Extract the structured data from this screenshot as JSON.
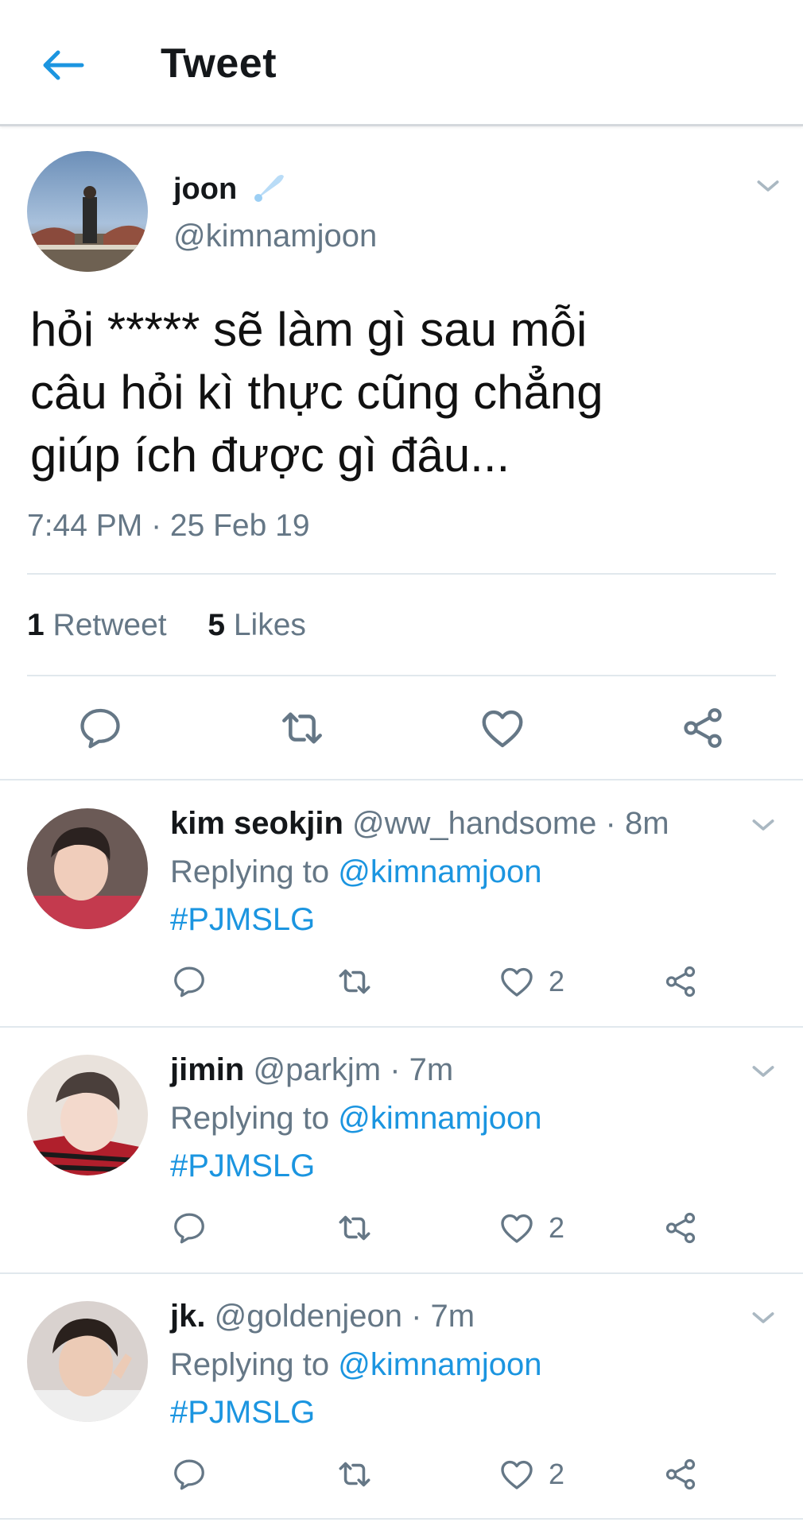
{
  "header": {
    "title": "Tweet"
  },
  "tweet": {
    "name": "joon",
    "handle": "@kimnamjoon",
    "text_lines": [
      "hỏi ***** sẽ làm gì sau mỗi",
      "câu hỏi kì thực cũng chẳng",
      "giúp ích được gì đâu..."
    ],
    "timestamp": "7:44 PM · 25 Feb 19",
    "retweets_count": "1",
    "retweets_label": "Retweet",
    "likes_count": "5",
    "likes_label": "Likes"
  },
  "replies": [
    {
      "name": "kim seokjin",
      "handle": "@ww_handsome",
      "time": "· 8m",
      "replying_label": "Replying to",
      "replying_to": "@kimnamjoon",
      "text": "#PJMSLG",
      "likes": "2"
    },
    {
      "name": "jimin",
      "handle": "@parkjm",
      "time": "· 7m",
      "replying_label": "Replying to",
      "replying_to": "@kimnamjoon",
      "text": "#PJMSLG",
      "likes": "2"
    },
    {
      "name": "jk.",
      "handle": "@goldenjeon",
      "time": "· 7m",
      "replying_label": "Replying to",
      "replying_to": "@kimnamjoon",
      "text": "#PJMSLG",
      "likes": "2"
    }
  ],
  "colors": {
    "accent": "#1b95e0",
    "secondary_text": "#657786",
    "divider": "#e1e8ed"
  }
}
